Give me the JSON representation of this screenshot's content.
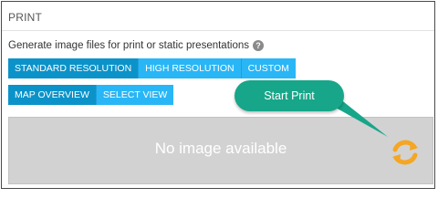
{
  "panel": {
    "title": "PRINT",
    "description": "Generate image files for print or static presentations",
    "help_icon": "?"
  },
  "resolution_options": [
    {
      "label": "STANDARD RESOLUTION",
      "active": true
    },
    {
      "label": "HIGH RESOLUTION",
      "active": false
    },
    {
      "label": "CUSTOM",
      "active": false
    }
  ],
  "view_options": [
    {
      "label": "MAP OVERVIEW",
      "active": true
    },
    {
      "label": "SELECT VIEW",
      "active": false
    }
  ],
  "preview": {
    "placeholder": "No image available",
    "refresh_icon": "refresh-icon"
  },
  "callout": {
    "text": "Start Print"
  },
  "colors": {
    "button": "#29b6f6",
    "button_active": "#0b93c9",
    "callout": "#17a689",
    "refresh_icon": "#f5a623",
    "preview_bg": "#d2d2d2"
  }
}
